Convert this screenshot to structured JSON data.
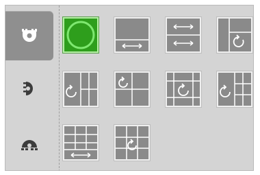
{
  "theme": {
    "panel_bg": "#d4d4d4",
    "tab_active_bg": "#8f8f8f",
    "tile_bg": "#8a8a8a",
    "tile_border": "#efefef",
    "tile_lines": "#ffffff",
    "selected_bg": "#2e9e1c",
    "selected_ring": "#7ee870"
  },
  "sidebar": {
    "tabs": [
      {
        "icon": "dome-top-icon",
        "active": true
      },
      {
        "icon": "dome-side-icon",
        "active": false
      },
      {
        "icon": "dome-bottom-icon",
        "active": false
      }
    ]
  },
  "layouts": [
    {
      "id": "single-circle",
      "selected": true
    },
    {
      "id": "two-rows-h-arrow"
    },
    {
      "id": "two-rows-two-arrows"
    },
    {
      "id": "corner-rotate"
    },
    {
      "id": "rotate-left-plus-grid"
    },
    {
      "id": "quad-rotate"
    },
    {
      "id": "center-rotate-grid"
    },
    {
      "id": "rotate-left-plus-grid-alt"
    },
    {
      "id": "grid-3x3-h-arrow"
    },
    {
      "id": "grid-3x3-center-rotate"
    }
  ]
}
